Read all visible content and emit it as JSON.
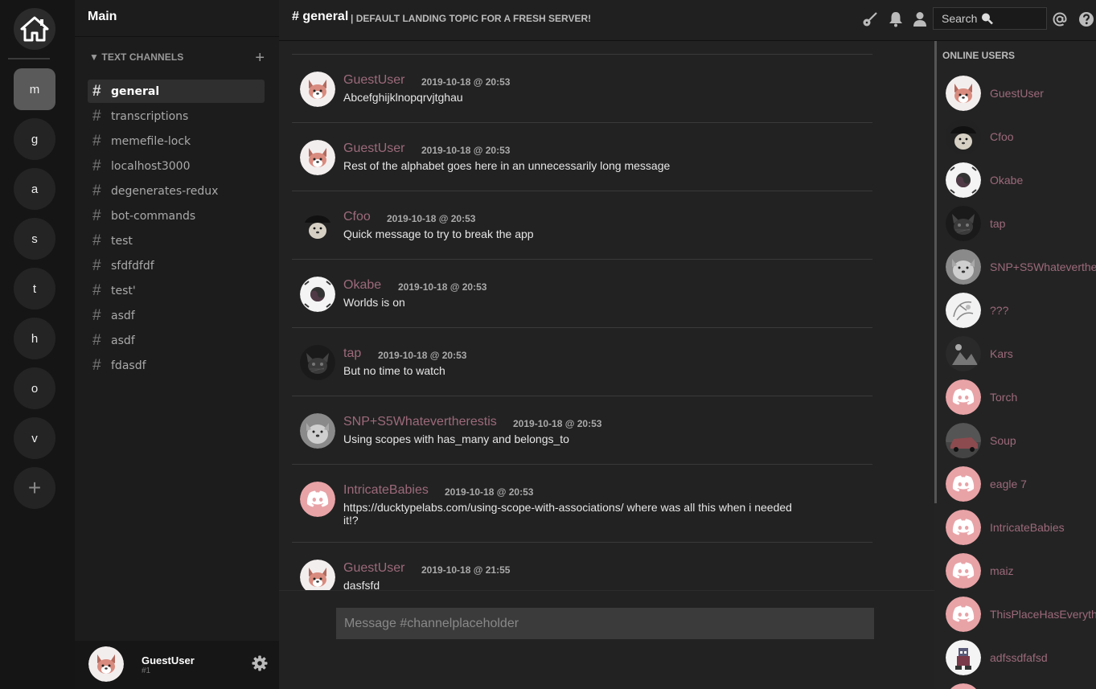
{
  "server_rail": {
    "servers": [
      {
        "letter": "m",
        "active": true
      },
      {
        "letter": "g"
      },
      {
        "letter": "a"
      },
      {
        "letter": "s"
      },
      {
        "letter": "t"
      },
      {
        "letter": "h"
      },
      {
        "letter": "o"
      },
      {
        "letter": "v"
      }
    ],
    "add_label": "+"
  },
  "sidebar": {
    "server_name": "Main",
    "category": "▼ TEXT CHANNELS",
    "add_label": "+",
    "channels": [
      {
        "name": "general",
        "active": true
      },
      {
        "name": "transcriptions"
      },
      {
        "name": "memefile-lock"
      },
      {
        "name": "localhost3000"
      },
      {
        "name": "degenerates-redux"
      },
      {
        "name": "bot-commands"
      },
      {
        "name": "test"
      },
      {
        "name": "sfdfdfdf"
      },
      {
        "name": "test'"
      },
      {
        "name": "asdf"
      },
      {
        "name": "asdf"
      },
      {
        "name": "fdasdf"
      }
    ]
  },
  "user_panel": {
    "name": "GuestUser",
    "tag": "#1"
  },
  "header": {
    "title": "# general",
    "topic": "| DEFAULT LANDING TOPIC FOR A FRESH SERVER!",
    "search_label": "Search"
  },
  "messages": [
    {
      "author": "GuestUser",
      "time": "2019-10-18 @ 20:53",
      "text": "Abcefghijklnopqrvjtghau",
      "avatar": "corgi"
    },
    {
      "author": "GuestUser",
      "time": "2019-10-18 @ 20:53",
      "text": "Rest of the alphabet goes here in an unnecessarily long message",
      "avatar": "corgi"
    },
    {
      "author": "Cfoo",
      "time": "2019-10-18 @ 20:53",
      "text": "Quick message to try to break the app",
      "avatar": "dog-hat"
    },
    {
      "author": "Okabe",
      "time": "2019-10-18 @ 20:53",
      "text": "Worlds is on",
      "avatar": "flag"
    },
    {
      "author": "tap",
      "time": "2019-10-18 @ 20:53",
      "text": "But no time to watch",
      "avatar": "cat"
    },
    {
      "author": "SNP+S5Whatevertherestis",
      "time": "2019-10-18 @ 20:53",
      "text": "Using scopes with has_many and belongs_to",
      "avatar": "doge"
    },
    {
      "author": "IntricateBabies",
      "time": "2019-10-18 @ 20:53",
      "text": "https://ducktypelabs.com/using-scope-with-associations/ where was all this when i needed it!?",
      "avatar": "discord"
    },
    {
      "author": "GuestUser",
      "time": "2019-10-18 @ 21:55",
      "text": "dasfsfd",
      "avatar": "corgi"
    }
  ],
  "composer": {
    "placeholder": "Message #channelplaceholder"
  },
  "online": {
    "header": "ONLINE USERS",
    "users": [
      {
        "name": "GuestUser",
        "avatar": "corgi"
      },
      {
        "name": "Cfoo",
        "avatar": "dog-hat"
      },
      {
        "name": "Okabe",
        "avatar": "flag"
      },
      {
        "name": "tap",
        "avatar": "cat"
      },
      {
        "name": "SNP+S5Whateverthe",
        "avatar": "doge"
      },
      {
        "name": "???",
        "avatar": "sketch"
      },
      {
        "name": "Kars",
        "avatar": "photo"
      },
      {
        "name": "Torch",
        "avatar": "discord"
      },
      {
        "name": "Soup",
        "avatar": "car"
      },
      {
        "name": "eagle 7",
        "avatar": "discord"
      },
      {
        "name": "IntricateBabies",
        "avatar": "discord"
      },
      {
        "name": "maiz",
        "avatar": "discord"
      },
      {
        "name": "ThisPlaceHasEveryth",
        "avatar": "discord"
      },
      {
        "name": "adfssdfafsd",
        "avatar": "pixel"
      },
      {
        "name": "",
        "avatar": "discord"
      }
    ]
  },
  "colors": {
    "author": "#9c6a7b",
    "discord_avatar": "#e8a3a7"
  }
}
